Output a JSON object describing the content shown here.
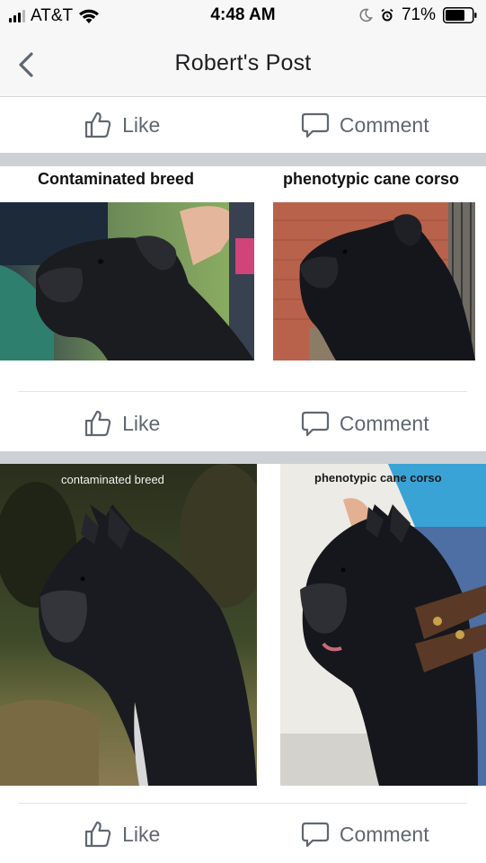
{
  "status_bar": {
    "carrier": "AT&T",
    "time": "4:48 AM",
    "battery": "71%"
  },
  "header": {
    "title": "Robert's Post"
  },
  "actions": {
    "like_label": "Like",
    "comment_label": "Comment"
  },
  "comparison_1": {
    "left_label": "Contaminated breed",
    "right_label": "phenotypic cane corso"
  },
  "comparison_2": {
    "left_label": "contaminated breed",
    "right_label": "phenotypic cane corso"
  },
  "colors": {
    "header_bg": "#f7f7f7",
    "separator": "#cdd0d4",
    "action_text": "#606770"
  },
  "icons": [
    "back-chevron-icon",
    "thumbs-up-icon",
    "comment-bubble-icon",
    "wifi-icon",
    "moon-icon",
    "alarm-icon",
    "battery-icon"
  ]
}
